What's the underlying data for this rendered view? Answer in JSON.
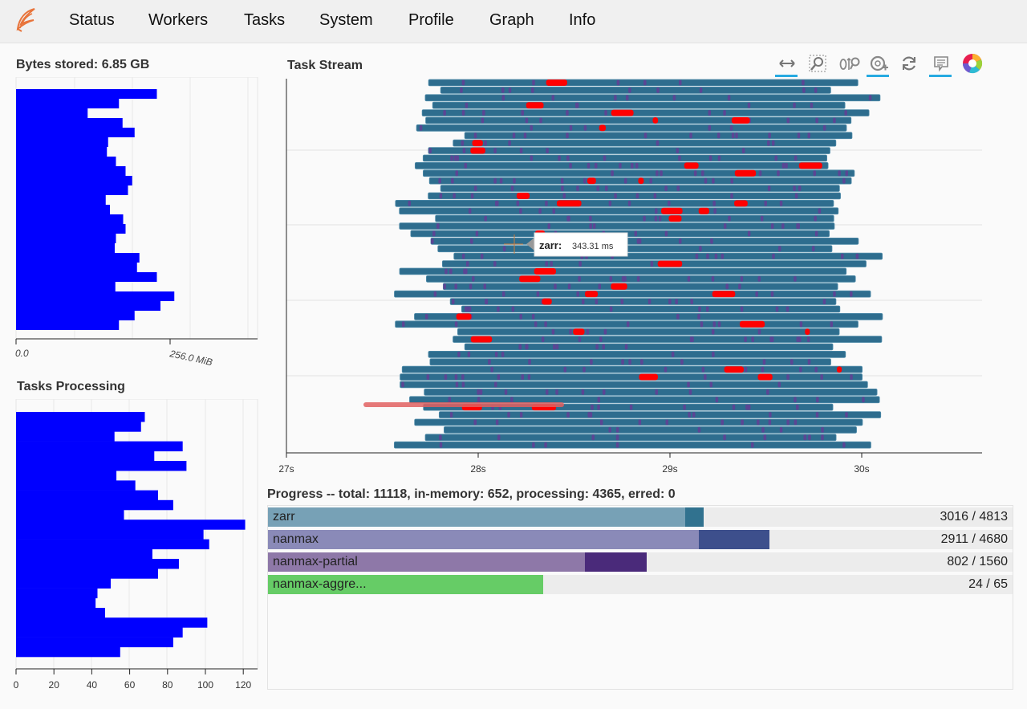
{
  "nav": {
    "items": [
      "Status",
      "Workers",
      "Tasks",
      "System",
      "Profile",
      "Graph",
      "Info"
    ]
  },
  "memory_panel": {
    "title": "Bytes stored: 6.85 GB",
    "tick_labels": [
      "0.0",
      "256.0 MiB"
    ]
  },
  "processing_panel": {
    "title": "Tasks Processing",
    "tick_labels": [
      "0",
      "20",
      "40",
      "60",
      "80",
      "100",
      "120"
    ]
  },
  "task_stream": {
    "title": "Task Stream",
    "tick_labels": [
      "27s",
      "28s",
      "29s",
      "30s"
    ],
    "tooltip": {
      "label": "zarr:",
      "value": "343.31 ms"
    },
    "toolbar": [
      "pan-tool-icon",
      "box-zoom-tool-icon",
      "wheel-zoom-tool-icon",
      "save-plus-tool-icon",
      "reset-tool-icon",
      "hover-tool-icon",
      "bokeh-logo-icon"
    ],
    "colors": {
      "task": "#2e6d8e",
      "transfer": "#ff0000",
      "compute_marker": "#5b4594"
    }
  },
  "progress": {
    "title": "Progress -- total: 11118, in-memory: 652, processing: 4365, erred: 0",
    "rows": [
      {
        "name": "zarr",
        "count": "3016 / 4813",
        "done": 2697,
        "processing": 118,
        "color": "#77a1b6",
        "proc_color": "#31728f"
      },
      {
        "name": "nanmax",
        "count": "2911 / 4680",
        "done": 2708,
        "processing": 446,
        "color": "#8a8ab8",
        "proc_color": "#3d4f8c"
      },
      {
        "name": "nanmax-partial",
        "count": "802 / 1560",
        "done": 664,
        "processing": 129,
        "color": "#8e78a8",
        "proc_color": "#4a2a7a"
      },
      {
        "name": "nanmax-aggre...",
        "count": "24 / 65",
        "done": 24,
        "processing": 0,
        "color": "#66cc66",
        "proc_color": "#66cc66"
      }
    ]
  },
  "chart_data": [
    {
      "type": "bar",
      "title": "Bytes stored: 6.85 GB",
      "orientation": "horizontal",
      "unit": "MiB",
      "xlim": [
        0,
        256
      ],
      "values": [
        234,
        171,
        119,
        177,
        197,
        153,
        151,
        166,
        182,
        193,
        186,
        149,
        156,
        178,
        182,
        166,
        164,
        205,
        201,
        234,
        165,
        263,
        240,
        197,
        171
      ]
    },
    {
      "type": "bar",
      "title": "Tasks Processing",
      "orientation": "horizontal",
      "xlim": [
        0,
        120
      ],
      "values": [
        68,
        66,
        52,
        88,
        73,
        90,
        53,
        63,
        75,
        83,
        57,
        121,
        99,
        102,
        72,
        86,
        75,
        50,
        43,
        42,
        47,
        101,
        88,
        83,
        55
      ]
    }
  ]
}
